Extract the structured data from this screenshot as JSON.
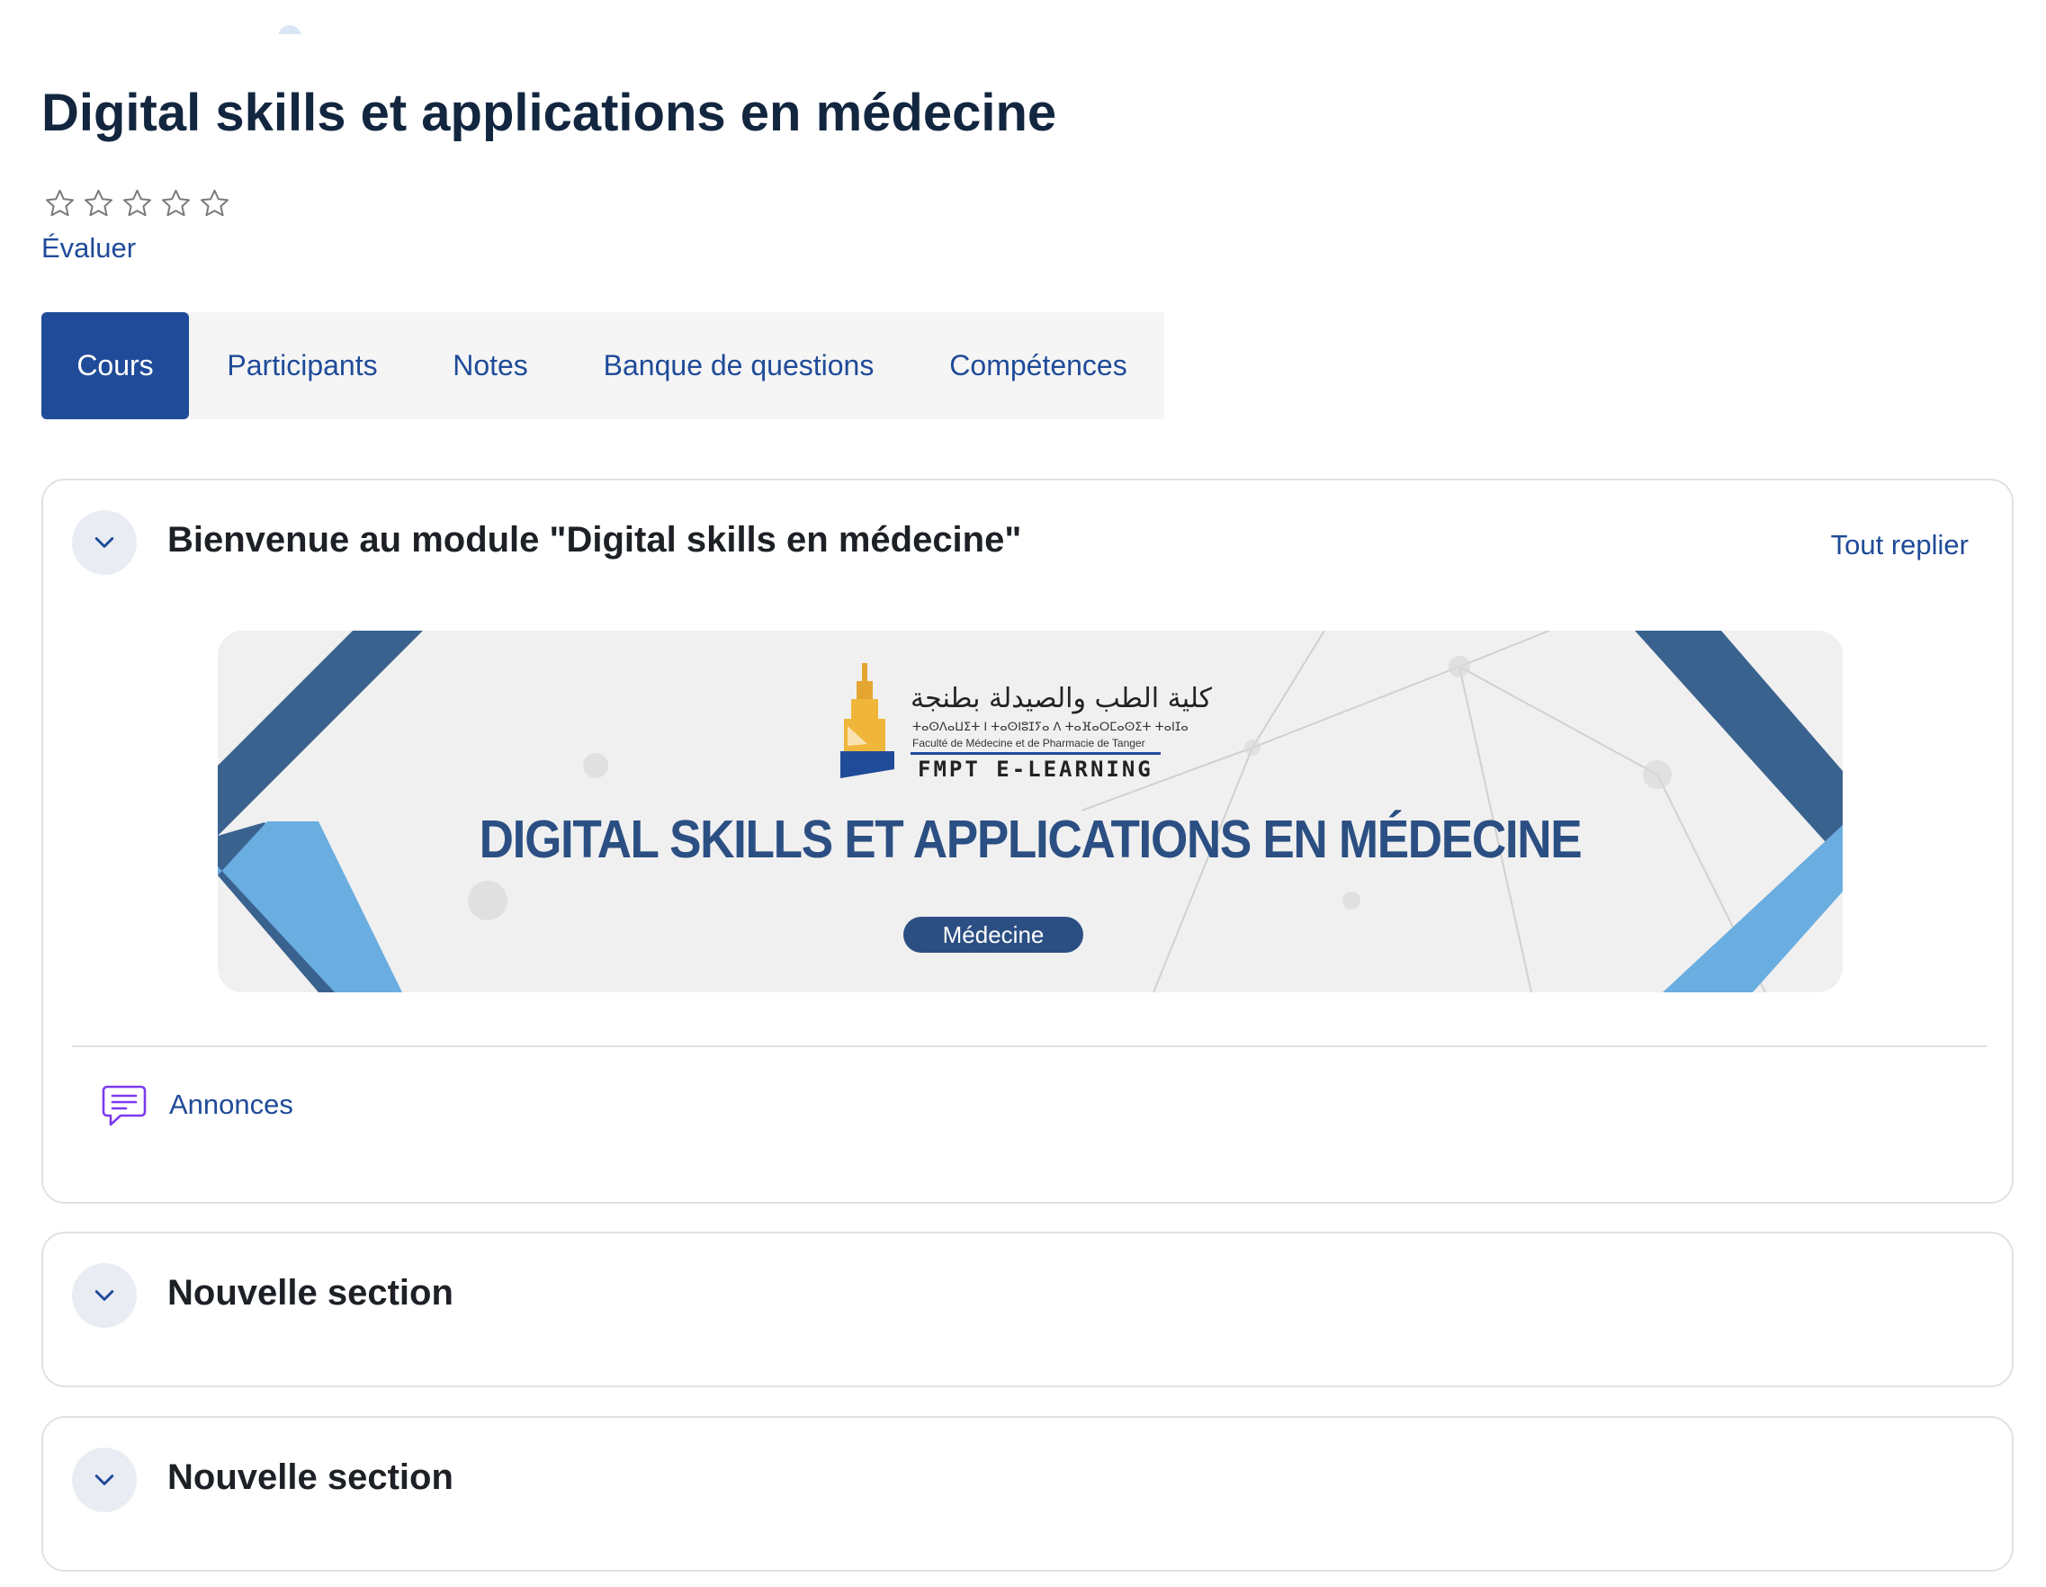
{
  "course": {
    "title": "Digital skills et applications en médecine",
    "rating_stars": 0,
    "rating_max": 5,
    "rate_link": "Évaluer"
  },
  "tabs": [
    {
      "label": "Cours",
      "active": true
    },
    {
      "label": "Participants",
      "active": false
    },
    {
      "label": "Notes",
      "active": false
    },
    {
      "label": "Banque de questions",
      "active": false
    },
    {
      "label": "Compétences",
      "active": false
    }
  ],
  "sections": [
    {
      "title": "Bienvenue au module \"Digital skills en médecine\"",
      "collapse_all": "Tout replier",
      "banner": {
        "logo_arabic": "كلية الطب والصيدلة بطنجة",
        "logo_tifinagh": "ⵜⴰⵙⴷⴰⵡⵉⵜ ⵏ ⵜⴰⵙⵏⵓⵊⵢⴰ ⴷ ⵜⴰⴼⴰⵔⵎⴰⵙⵉⵜ ⵜⴰⵏⵊⴰ",
        "logo_french": "Faculté de Médecine et de Pharmacie de Tanger",
        "logo_brand": "FMPT E-LEARNING",
        "title": "DIGITAL SKILLS ET APPLICATIONS EN MÉDECINE",
        "badge": "Médecine"
      },
      "activities": [
        {
          "label": "Annonces",
          "icon": "forum-icon"
        }
      ]
    },
    {
      "title": "Nouvelle section"
    },
    {
      "title": "Nouvelle section"
    }
  ],
  "colors": {
    "primary": "#1f4b99",
    "banner_dark_blue": "#3a628f",
    "banner_light_blue": "#6aade0",
    "title": "#12263f"
  }
}
